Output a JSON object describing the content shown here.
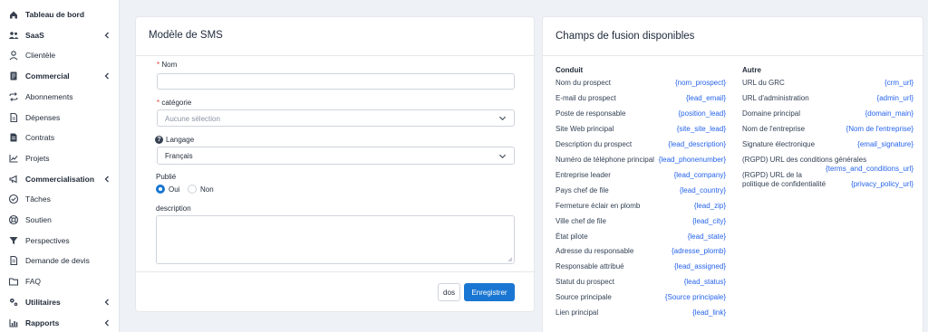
{
  "sidebar": {
    "items": [
      {
        "label": "Tableau de bord",
        "bold": true,
        "icon": "home-icon",
        "has_chevron": false
      },
      {
        "label": "SaaS",
        "bold": true,
        "icon": "users-icon",
        "has_chevron": true
      },
      {
        "label": "Clientèle",
        "bold": false,
        "icon": "user-icon",
        "has_chevron": false
      },
      {
        "label": "Commercial",
        "bold": true,
        "icon": "receipt-icon",
        "has_chevron": true
      },
      {
        "label": "Abonnements",
        "bold": false,
        "icon": "repeat-icon",
        "has_chevron": false
      },
      {
        "label": "Dépenses",
        "bold": false,
        "icon": "file-icon",
        "has_chevron": false
      },
      {
        "label": "Contrats",
        "bold": false,
        "icon": "document-icon",
        "has_chevron": false
      },
      {
        "label": "Projets",
        "bold": false,
        "icon": "chart-icon",
        "has_chevron": false
      },
      {
        "label": "Commercialisation",
        "bold": true,
        "icon": "megaphone-icon",
        "has_chevron": true
      },
      {
        "label": "Tâches",
        "bold": false,
        "icon": "check-circle-icon",
        "has_chevron": false
      },
      {
        "label": "Soutien",
        "bold": false,
        "icon": "lifebuoy-icon",
        "has_chevron": false
      },
      {
        "label": "Perspectives",
        "bold": false,
        "icon": "funnel-icon",
        "has_chevron": false
      },
      {
        "label": "Demande de devis",
        "bold": false,
        "icon": "page-icon",
        "has_chevron": false
      },
      {
        "label": "FAQ",
        "bold": false,
        "icon": "folder-icon",
        "has_chevron": false
      },
      {
        "label": "Utilitaires",
        "bold": true,
        "icon": "cogs-icon",
        "has_chevron": true
      },
      {
        "label": "Rapports",
        "bold": true,
        "icon": "bar-chart-icon",
        "has_chevron": true
      }
    ]
  },
  "form": {
    "title": "Modèle de SMS",
    "name_label": "Nom",
    "name_required_mark": "*",
    "name_value": "",
    "category_label": "catégorie",
    "category_required_mark": "*",
    "category_value": "Aucune sélection",
    "language_help_icon": "?",
    "language_label": "Langage",
    "language_value": "Français",
    "published_label": "Publié",
    "published_yes": "Oui",
    "published_no": "Non",
    "published_selected": "Oui",
    "description_label": "description",
    "description_value": "",
    "back_button": "dos",
    "save_button": "Enregistrer"
  },
  "merge_fields": {
    "title": "Champs de fusion disponibles",
    "lead_section": {
      "title": "Conduit",
      "rows": [
        {
          "label": "Nom du prospect",
          "key": "{nom_prospect}"
        },
        {
          "label": "E-mail du prospect",
          "key": "{lead_email}"
        },
        {
          "label": "Poste de responsable",
          "key": "{position_lead}"
        },
        {
          "label": "Site Web principal",
          "key": "{site_site_lead}"
        },
        {
          "label": "Description du prospect",
          "key": "{lead_description}"
        },
        {
          "label": "Numéro de téléphone principal",
          "key": "{lead_phonenumber}"
        },
        {
          "label": "Entreprise leader",
          "key": "{lead_company}"
        },
        {
          "label": "Pays chef de file",
          "key": "{lead_country}"
        },
        {
          "label": "Fermeture éclair en plomb",
          "key": "{lead_zip}"
        },
        {
          "label": "Ville chef de file",
          "key": "{lead_city}"
        },
        {
          "label": "État pilote",
          "key": "{lead_state}"
        },
        {
          "label": "Adresse du responsable",
          "key": "{adresse_plomb}"
        },
        {
          "label": "Responsable attribué",
          "key": "{lead_assigned}"
        },
        {
          "label": "Statut du prospect",
          "key": "{lead_status}"
        },
        {
          "label": "Source principale",
          "key": "{Source principale}"
        },
        {
          "label": "Lien principal",
          "key": "{lead_link}"
        }
      ]
    },
    "other_section": {
      "title": "Autre",
      "rows": [
        {
          "label": "URL du GRC",
          "key": "{crm_url}"
        },
        {
          "label": "URL d'administration",
          "key": "{admin_url}"
        },
        {
          "label": "Domaine principal",
          "key": "{domain_main}"
        },
        {
          "label": "Nom de l'entreprise",
          "key": "{Nom de l'entreprise}"
        },
        {
          "label": "Signature électronique",
          "key": "{email_signature}"
        },
        {
          "label": "(RGPD) URL des conditions générales",
          "key": "{terms_and_conditions_url}"
        },
        {
          "label": "(RGPD) URL de la politique de confidentialité",
          "key": "{privacy_policy_url}"
        }
      ]
    }
  },
  "colors": {
    "accent": "#1976d2",
    "link": "#2563eb",
    "required": "#e53935",
    "background": "#eef1f6"
  }
}
